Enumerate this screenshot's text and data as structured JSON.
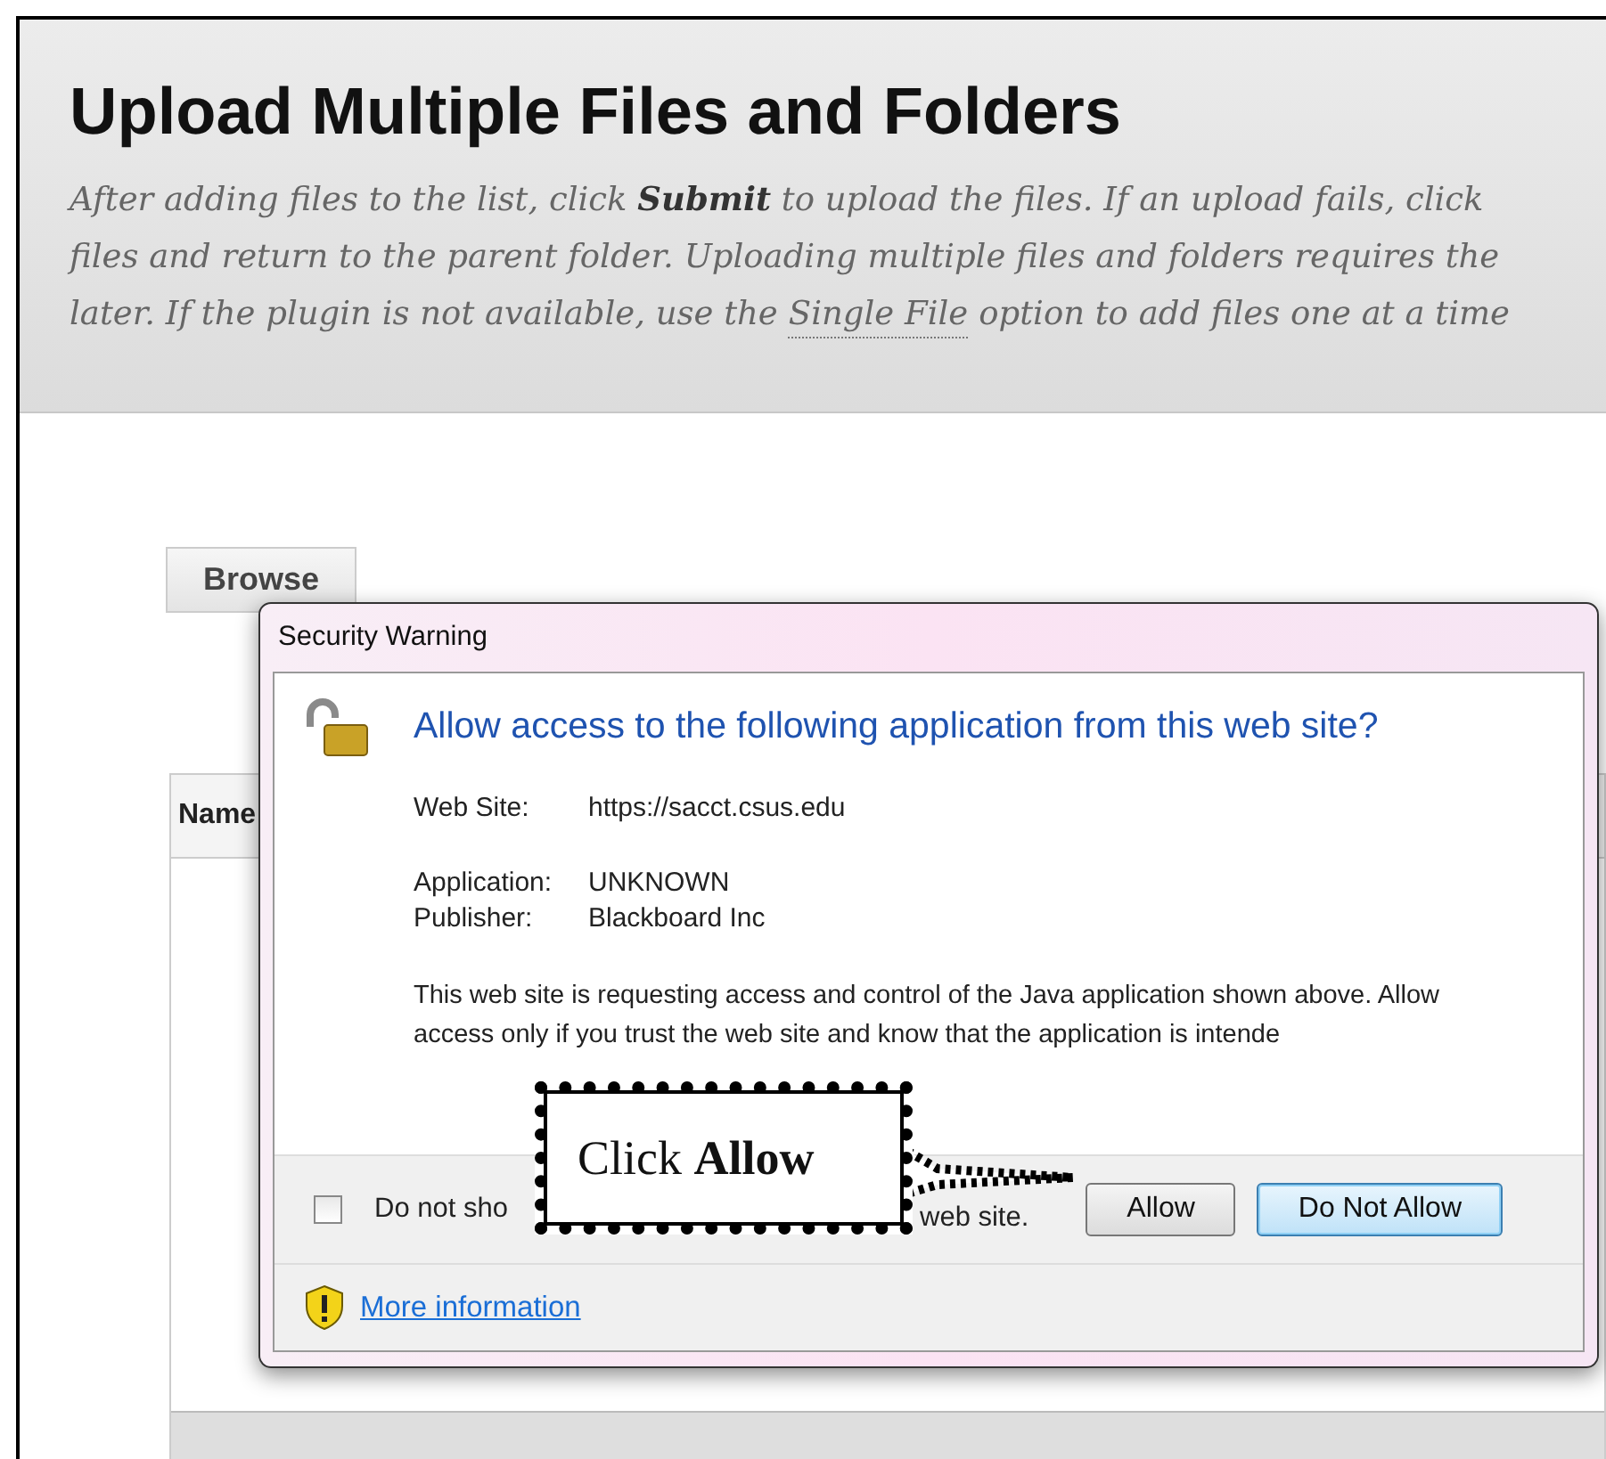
{
  "page": {
    "title": "Upload Multiple Files and Folders",
    "description_lines": [
      [
        {
          "kind": "text",
          "text": "After adding files to the list, click **Submit** to upload the files. If an upload fails, click"
        }
      ],
      [
        {
          "kind": "text",
          "text": "files and return to the parent folder. Uploading multiple files and folders requires the"
        }
      ],
      [
        {
          "kind": "text",
          "text": "later. If the plugin is not available, use the"
        },
        {
          "kind": "link",
          "text": "Single File"
        },
        {
          "kind": "text",
          "text": "option to add files one at a time"
        }
      ]
    ]
  },
  "browse_button": "Browse",
  "table": {
    "columns": [
      "Name"
    ]
  },
  "dialog": {
    "title": "Security Warning",
    "heading": "Allow access to the following application from this web site?",
    "detail_groups": [
      [
        {
          "label": "Web Site:",
          "value": "https://sacct.csus.edu"
        }
      ],
      [
        {
          "label": "Application:",
          "value": "UNKNOWN"
        },
        {
          "label": "Publisher:",
          "value": "Blackboard Inc"
        }
      ]
    ],
    "message": "This web site is requesting access and control of the Java application shown above. Allow access only if you trust the web site and know that the application is intende",
    "checkbox": {
      "label": "Do not sho",
      "checked": false
    },
    "trailing_text": "web site.",
    "buttons": [
      {
        "label": "Allow",
        "default": false
      },
      {
        "label": "Do Not Allow",
        "default": true
      }
    ],
    "link": "More information"
  },
  "callout": {
    "text": "Click **Allow**"
  }
}
